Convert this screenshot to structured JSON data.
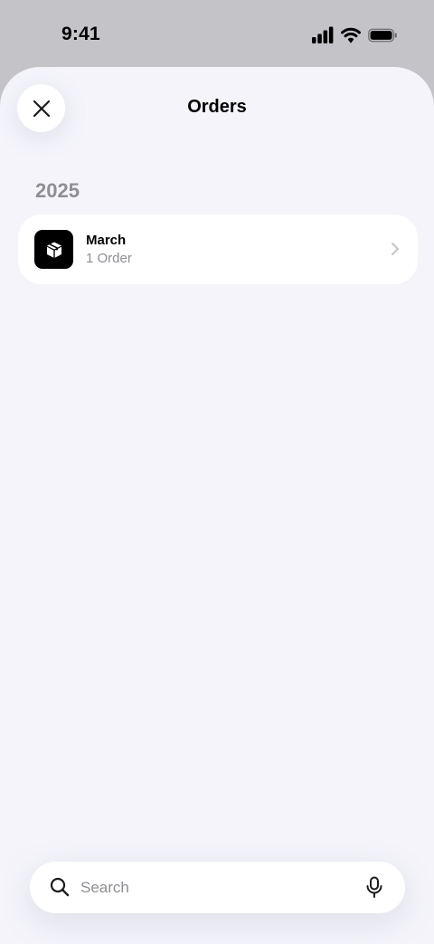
{
  "status_bar": {
    "time": "9:41",
    "icons": [
      "cellular-signal-icon",
      "wifi-icon",
      "battery-icon"
    ]
  },
  "header": {
    "title": "Orders",
    "close_icon": "close-icon"
  },
  "sections": [
    {
      "year": "2025",
      "items": [
        {
          "title": "March",
          "subtitle": "1 Order",
          "icon": "package-box-icon"
        }
      ]
    }
  ],
  "search": {
    "placeholder": "Search",
    "value": "",
    "icons": [
      "search-icon",
      "microphone-icon"
    ]
  },
  "colors": {
    "sheet_background": "#f4f4fa",
    "status_background": "#c4c4c8",
    "secondary_text": "#8e8e93",
    "card_background": "#ffffff",
    "icon_tile": "#000000"
  }
}
